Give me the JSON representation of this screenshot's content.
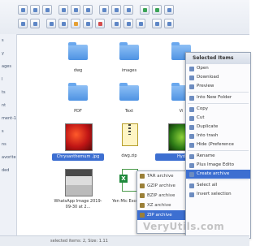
{
  "sidebar": {
    "items": [
      "s",
      "y",
      "ages",
      "l",
      "ts",
      "nt",
      "ment-1.docx",
      "s",
      "ns",
      "avorite",
      "ded"
    ]
  },
  "files": {
    "dwg_folder": "dwg",
    "images_folder": "images",
    "pdf_folder": "PDF",
    "text_folder": "Text",
    "v_folder": "Vi",
    "chrysanthemum": "Chrysanthemum .jpg",
    "dwg_zip": "dwg.zip",
    "hydrangeas": "Hyd",
    "whatsapp": "WhatsApp Image 2019-09-30 at 2...",
    "excel": "Yen Mic Excel Ca"
  },
  "context_menu": {
    "header": "Selected Items",
    "items": [
      "Open",
      "Download",
      "Preview",
      "Into New Folder",
      "Copy",
      "Cut",
      "Duplicate",
      "Into trash",
      "Hide (Preference",
      "Rename",
      "Plus Image Edito",
      "Create archive",
      "Select all",
      "Invert selection"
    ]
  },
  "archive_submenu": {
    "items": [
      "TAR archive",
      "GZIP archive",
      "BZIP archive",
      "XZ archive",
      "ZIP archive"
    ]
  },
  "status": {
    "text": "selected items: 2, Size: 1.11"
  },
  "watermark": "VeryUtils.com"
}
